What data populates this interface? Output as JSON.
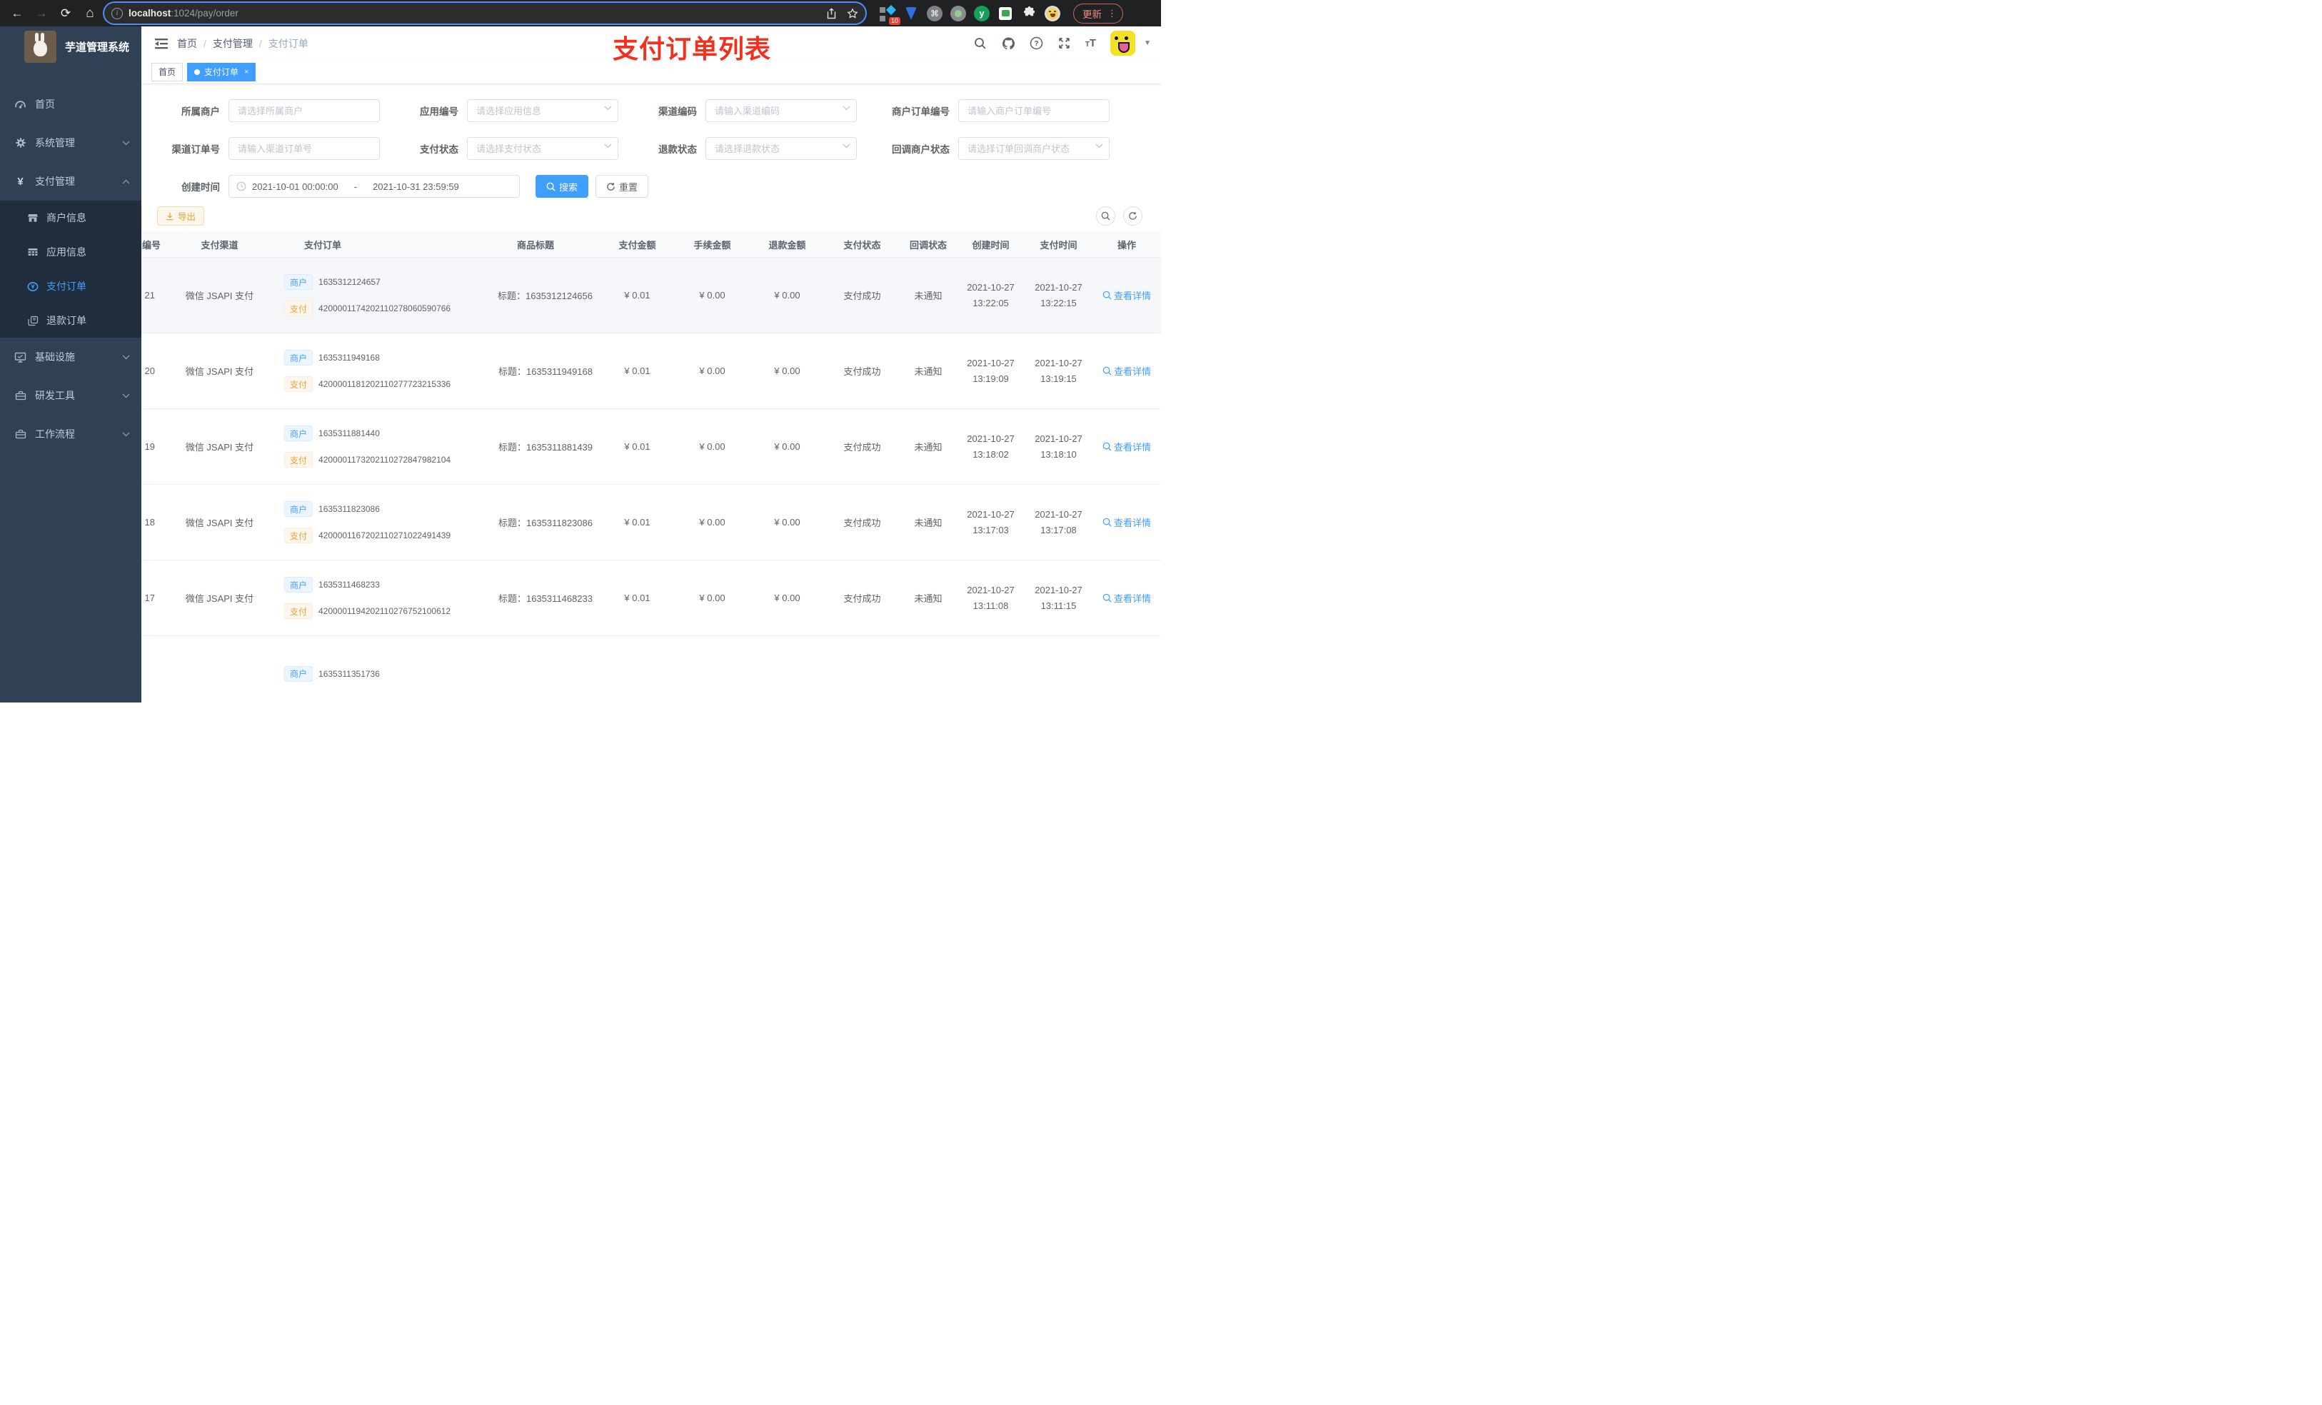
{
  "browser": {
    "url_host": "localhost",
    "url_rest": ":1024/pay/order",
    "extension_badge": "10",
    "update_label": "更新"
  },
  "sidebar": {
    "title": "芋道管理系统",
    "items": {
      "home": "首页",
      "system": "系统管理",
      "pay": "支付管理",
      "merchant_info": "商户信息",
      "app_info": "应用信息",
      "pay_order": "支付订单",
      "refund_order": "退款订单",
      "infra": "基础设施",
      "devtools": "研发工具",
      "workflow": "工作流程"
    }
  },
  "navbar": {
    "breadcrumb": [
      "首页",
      "支付管理",
      "支付订单"
    ],
    "annotation": "支付订单列表"
  },
  "tags": {
    "home": "首页",
    "active": "支付订单",
    "close": "×"
  },
  "filters": {
    "items": [
      {
        "label": "所属商户",
        "placeholder": "请选择所属商户",
        "select": false
      },
      {
        "label": "应用编号",
        "placeholder": "请选择应用信息",
        "select": true
      },
      {
        "label": "渠道编码",
        "placeholder": "请输入渠道编码",
        "select": true
      },
      {
        "label": "商户订单编号",
        "placeholder": "请输入商户订单编号",
        "select": false
      },
      {
        "label": "渠道订单号",
        "placeholder": "请输入渠道订单号",
        "select": false
      },
      {
        "label": "支付状态",
        "placeholder": "请选择支付状态",
        "select": true
      },
      {
        "label": "退款状态",
        "placeholder": "请选择退款状态",
        "select": true
      },
      {
        "label": "回调商户状态",
        "placeholder": "请选择订单回调商户状态",
        "select": true
      }
    ],
    "date_label": "创建时间",
    "date_start": "2021-10-01 00:00:00",
    "date_separator": "-",
    "date_end": "2021-10-31 23:59:59",
    "search_label": "搜索",
    "reset_label": "重置"
  },
  "toolbar": {
    "export_label": "导出"
  },
  "table": {
    "tag_merchant": "商户",
    "tag_payment": "支付",
    "columns": [
      "编号",
      "支付渠道",
      "支付订单",
      "商品标题",
      "支付金额",
      "手续金额",
      "退款金额",
      "支付状态",
      "回调状态",
      "创建时间",
      "支付时间",
      "操作"
    ],
    "rows": [
      {
        "id": "21",
        "channel": "微信 JSAPI 支付",
        "merchant_no": "1635312124657",
        "payment_no": "4200001174202110278060590766",
        "title": "标题：1635312124656",
        "amount": "¥ 0.01",
        "fee": "¥ 0.00",
        "refund": "¥ 0.00",
        "pay_status": "支付成功",
        "notify_status": "未通知",
        "created_date": "2021-10-27",
        "created_time": "13:22:05",
        "paid_date": "2021-10-27",
        "paid_time": "13:22:15",
        "action": "查看详情",
        "hover": true
      },
      {
        "id": "20",
        "channel": "微信 JSAPI 支付",
        "merchant_no": "1635311949168",
        "payment_no": "4200001181202110277723215336",
        "title": "标题：1635311949168",
        "amount": "¥ 0.01",
        "fee": "¥ 0.00",
        "refund": "¥ 0.00",
        "pay_status": "支付成功",
        "notify_status": "未通知",
        "created_date": "2021-10-27",
        "created_time": "13:19:09",
        "paid_date": "2021-10-27",
        "paid_time": "13:19:15",
        "action": "查看详情",
        "hover": false
      },
      {
        "id": "19",
        "channel": "微信 JSAPI 支付",
        "merchant_no": "1635311881440",
        "payment_no": "4200001173202110272847982104",
        "title": "标题：1635311881439",
        "amount": "¥ 0.01",
        "fee": "¥ 0.00",
        "refund": "¥ 0.00",
        "pay_status": "支付成功",
        "notify_status": "未通知",
        "created_date": "2021-10-27",
        "created_time": "13:18:02",
        "paid_date": "2021-10-27",
        "paid_time": "13:18:10",
        "action": "查看详情",
        "hover": false
      },
      {
        "id": "18",
        "channel": "微信 JSAPI 支付",
        "merchant_no": "1635311823086",
        "payment_no": "4200001167202110271022491439",
        "title": "标题：1635311823086",
        "amount": "¥ 0.01",
        "fee": "¥ 0.00",
        "refund": "¥ 0.00",
        "pay_status": "支付成功",
        "notify_status": "未通知",
        "created_date": "2021-10-27",
        "created_time": "13:17:03",
        "paid_date": "2021-10-27",
        "paid_time": "13:17:08",
        "action": "查看详情",
        "hover": false
      },
      {
        "id": "17",
        "channel": "微信 JSAPI 支付",
        "merchant_no": "1635311468233",
        "payment_no": "4200001194202110276752100612",
        "title": "标题：1635311468233",
        "amount": "¥ 0.01",
        "fee": "¥ 0.00",
        "refund": "¥ 0.00",
        "pay_status": "支付成功",
        "notify_status": "未通知",
        "created_date": "2021-10-27",
        "created_time": "13:11:08",
        "paid_date": "2021-10-27",
        "paid_time": "13:11:15",
        "action": "查看详情",
        "hover": false
      },
      {
        "id": "",
        "channel": "",
        "merchant_no": "1635311351736",
        "payment_no": "",
        "title": "",
        "amount": "",
        "fee": "",
        "refund": "",
        "pay_status": "",
        "notify_status": "",
        "created_date": "",
        "created_time": "",
        "paid_date": "",
        "paid_time": "",
        "action": "",
        "hover": false
      }
    ]
  }
}
